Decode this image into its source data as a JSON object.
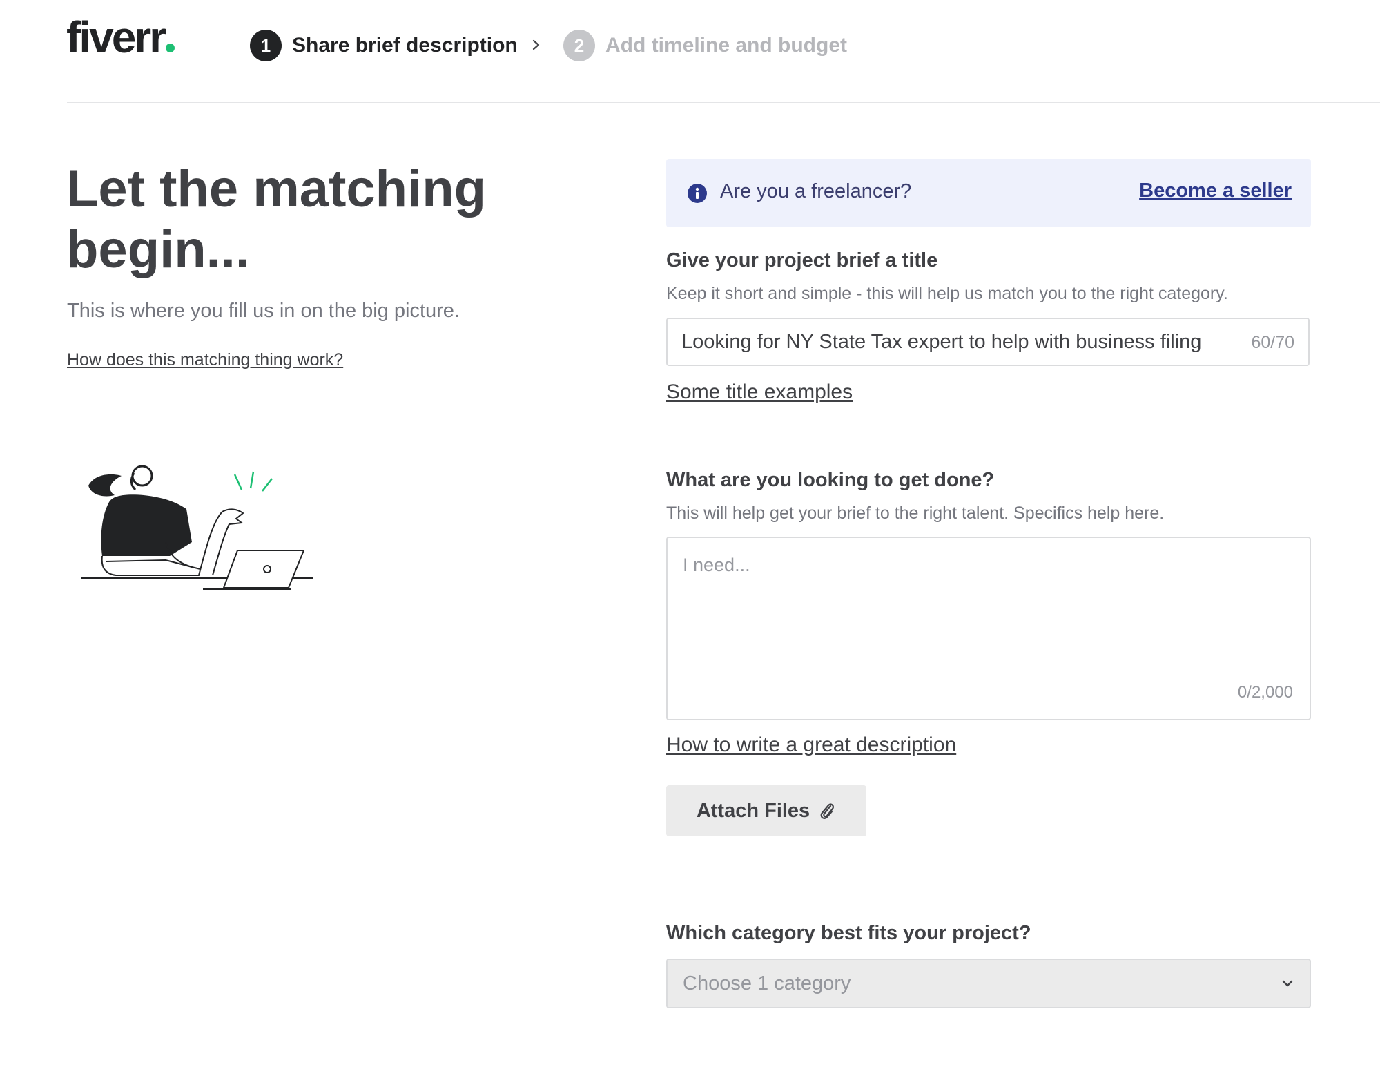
{
  "header": {
    "logo_text": "fiverr",
    "steps": [
      {
        "number": "1",
        "label": "Share brief description",
        "active": true
      },
      {
        "number": "2",
        "label": "Add timeline and budget",
        "active": false
      }
    ]
  },
  "hero": {
    "title": "Let the matching begin...",
    "subtitle": "This is where you fill us in on the big picture.",
    "link": "How does this matching thing work?"
  },
  "banner": {
    "text": "Are you a freelancer?",
    "link": "Become a seller"
  },
  "title_field": {
    "label": "Give your project brief a title",
    "helper": "Keep it short and simple - this will help us match you to the right category.",
    "value": "Looking for NY State Tax expert to help with business filing",
    "count": "60/70",
    "examples_link": "Some title examples"
  },
  "description_field": {
    "label": "What are you looking to get done?",
    "helper": "This will help get your brief to the right talent. Specifics help here.",
    "placeholder": "I need...",
    "count": "0/2,000",
    "help_link": "How to write a great description"
  },
  "attach": {
    "label": "Attach Files"
  },
  "category": {
    "label": "Which category best fits your project?",
    "placeholder": "Choose 1 category"
  },
  "colors": {
    "brand_green": "#1dbf73",
    "text_dark": "#404145",
    "banner_bg": "#eef1fc",
    "banner_link": "#2d3a8c"
  }
}
